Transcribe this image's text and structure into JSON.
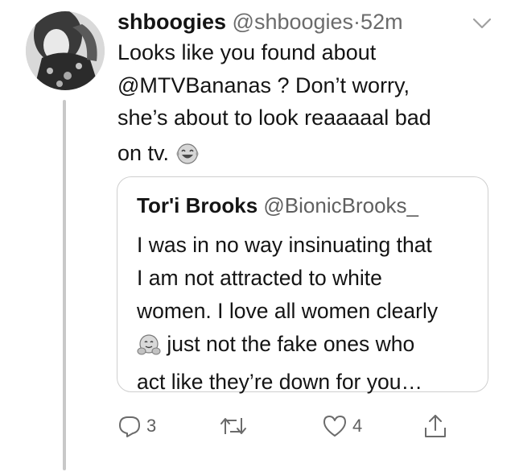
{
  "tweet": {
    "display_name": "shboogies",
    "handle": "@shboogies",
    "separator": "·",
    "time": "52m",
    "text_line1": "Looks like you found about",
    "mention": "@MTVBananas",
    "text_line2_rest": " ?  Don’t worry,",
    "text_line3": "she’s about to look reaaaaal bad",
    "text_line4": "on tv.",
    "emoji_icon": "face-with-tears-of-joy-icon"
  },
  "quoted_tweet": {
    "display_name": "Tor'i Brooks",
    "handle": "@BionicBrooks_",
    "line1": "I was in no way insinuating that",
    "line2": "I am not attracted to white",
    "line3": "women. I love all women clearly",
    "line4": " just not the fake ones who",
    "line5": "act like they’re down for you…",
    "emoji_icon": "hugging-face-icon"
  },
  "actions": {
    "reply_count": "3",
    "retweet_count": "",
    "like_count": "4"
  }
}
